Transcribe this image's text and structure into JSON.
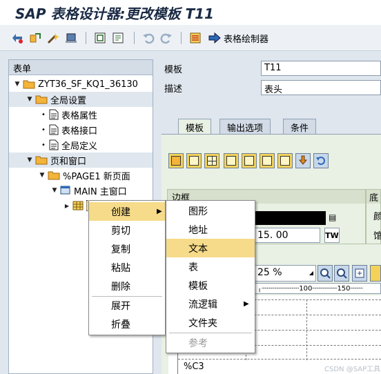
{
  "window": {
    "title": "SAP 表格设计器:更改模板 T11"
  },
  "toolbar": {
    "form_painter_label": "表格绘制器"
  },
  "tree": {
    "header": "表单",
    "rows": [
      {
        "label": "ZYT36_SF_KQ1_36130"
      },
      {
        "label": "全局设置"
      },
      {
        "label": "表格属性"
      },
      {
        "label": "表格接口"
      },
      {
        "label": "全局定义"
      },
      {
        "label": "页和窗口"
      },
      {
        "label": "%PAGE1 新页面"
      },
      {
        "label": "MAIN 主窗口"
      }
    ]
  },
  "detail": {
    "template_label": "模板",
    "template_value": "T11",
    "desc_label": "描述",
    "desc_value": "表头"
  },
  "tabs": [
    "模板",
    "输出选项",
    "条件"
  ],
  "frame": {
    "title": "边框",
    "right_title": "底",
    "right_char1": "颜",
    "right_char2": "馆"
  },
  "fields": {
    "width_value": "15. 00",
    "unit": "TW",
    "zoom_value": "25 %"
  },
  "ruler": {
    "tick1": "100",
    "tick2": "150"
  },
  "canvas": {
    "cell_label": "%C3"
  },
  "context_menu": {
    "items": [
      {
        "label": "创建"
      },
      {
        "label": "剪切"
      },
      {
        "label": "复制"
      },
      {
        "label": "粘贴"
      },
      {
        "label": "删除"
      },
      {
        "label": "展开"
      },
      {
        "label": "折叠"
      }
    ]
  },
  "submenu": {
    "items": [
      {
        "label": "图形"
      },
      {
        "label": "地址"
      },
      {
        "label": "文本"
      },
      {
        "label": "表"
      },
      {
        "label": "模板"
      },
      {
        "label": "流逻辑"
      },
      {
        "label": "文件夹"
      },
      {
        "label": "参考"
      }
    ]
  },
  "watermark": "CSDN @SAP工具士",
  "colors": {
    "highlight": "#f6db8a",
    "folder": "#f4b43a",
    "tab_body": "#e9f0e4"
  }
}
